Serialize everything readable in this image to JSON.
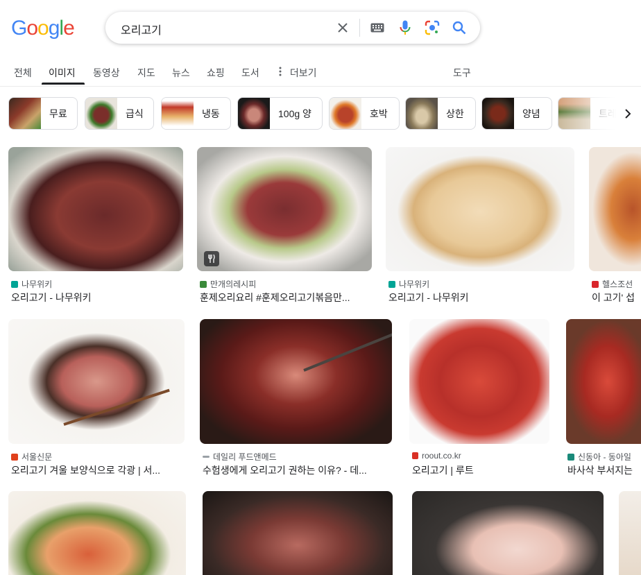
{
  "logo": {
    "letters": [
      "G",
      "o",
      "o",
      "g",
      "l",
      "e"
    ],
    "colors": [
      "#4285F4",
      "#EA4335",
      "#FBBC05",
      "#4285F4",
      "#34A853",
      "#EA4335"
    ]
  },
  "search": {
    "query": "오리고기"
  },
  "icons": {
    "clear": "close-icon",
    "keyboard": "keyboard-icon",
    "voice": "mic-icon",
    "lens": "lens-icon",
    "search": "search-icon"
  },
  "tabs": {
    "all": "전체",
    "images": "이미지",
    "videos": "동영상",
    "maps": "지도",
    "news": "뉴스",
    "shopping": "쇼핑",
    "books": "도서",
    "more": "더보기",
    "tools": "도구"
  },
  "chips": [
    "무료",
    "급식",
    "냉동",
    "100g 양",
    "호박",
    "상한",
    "양념",
    "트레"
  ],
  "results": [
    {
      "source": "나무위키",
      "title": "오리고기 - 나무위키",
      "fav_color": "#00a495"
    },
    {
      "source": "만개의레시피",
      "title": "훈제오리요리 #훈제오리고기볶음만...",
      "fav_color": "#3a8a3a"
    },
    {
      "source": "나무위키",
      "title": "오리고기 - 나무위키",
      "fav_color": "#00a495"
    },
    {
      "source": "헬스조선",
      "title": "이 고기' 섭",
      "fav_color": "#d9262c"
    },
    {
      "source": "서울신문",
      "title": "오리고기 겨울 보양식으로 각광 | 서...",
      "fav_color": "#e0401c"
    },
    {
      "source": "데일리 푸드앤메드",
      "title": "수험생에게 오리고기 권하는 이유? - 데...",
      "fav_color": "#9aa0a6"
    },
    {
      "source": "roout.co.kr",
      "title": "오리고기 | 루트",
      "fav_color": "#d93025"
    },
    {
      "source": "신동아 - 동아일",
      "title": "바사삭 부서지는",
      "fav_color": "#1a8a7a"
    }
  ]
}
